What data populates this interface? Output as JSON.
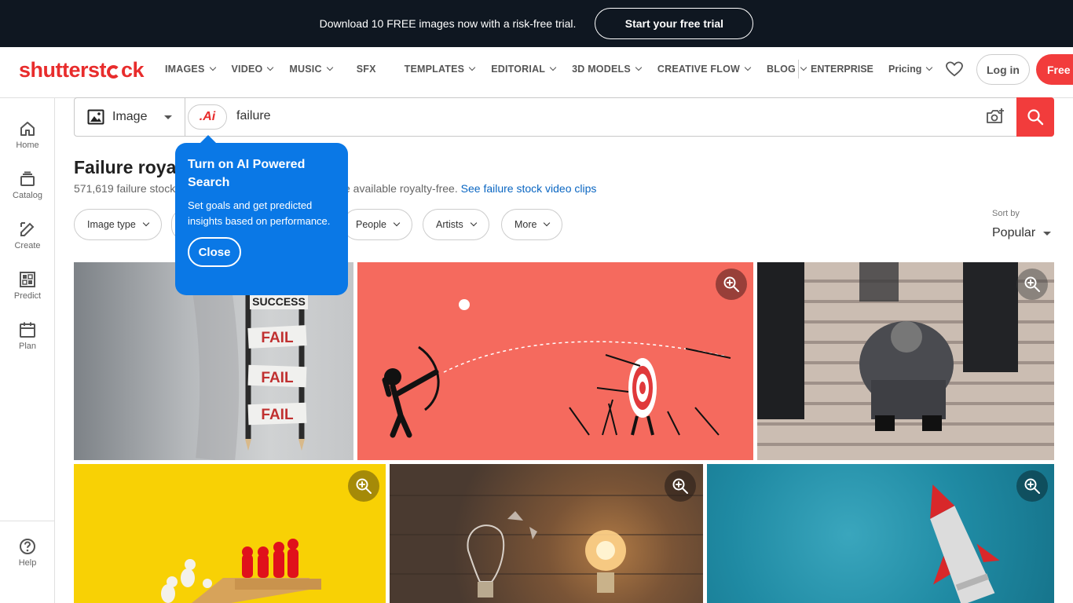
{
  "promo": {
    "text": "Download 10 FREE images now with a risk-free trial.",
    "button": "Start your free trial"
  },
  "nav": {
    "logo_pre": "shutterst",
    "logo_post": "ck",
    "items": [
      "IMAGES",
      "VIDEO",
      "MUSIC",
      "SFX",
      "TEMPLATES",
      "EDITORIAL",
      "3D MODELS",
      "CREATIVE FLOW",
      "BLOG"
    ],
    "enterprise": "ENTERPRISE",
    "pricing": "Pricing",
    "login": "Log in",
    "free": "Free t"
  },
  "sidebar": {
    "items": [
      "Home",
      "Catalog",
      "Create",
      "Predict",
      "Plan"
    ],
    "help": "Help"
  },
  "search": {
    "type": "Image",
    "ai_label": ".Ai",
    "query": "failure"
  },
  "results": {
    "title": "Failure royal",
    "subtitle_pre": "571,619 failure stock",
    "subtitle_post": "e available royalty-free.",
    "video_link": "See failure stock video clips"
  },
  "filters": [
    "Image type",
    "People",
    "Artists",
    "More"
  ],
  "sort": {
    "label": "Sort by",
    "value": "Popular"
  },
  "tooltip": {
    "title": "Turn on AI Powered Search",
    "body": "Set goals and get predicted insights based on performance.",
    "close": "Close"
  },
  "images": {
    "ladder": [
      "SUCCESS",
      "FAIL",
      "FAIL",
      "FAIL"
    ]
  },
  "colors": {
    "brand": "#e82c2c",
    "accent_blue": "#0a78e6",
    "link": "#0a66c2"
  }
}
